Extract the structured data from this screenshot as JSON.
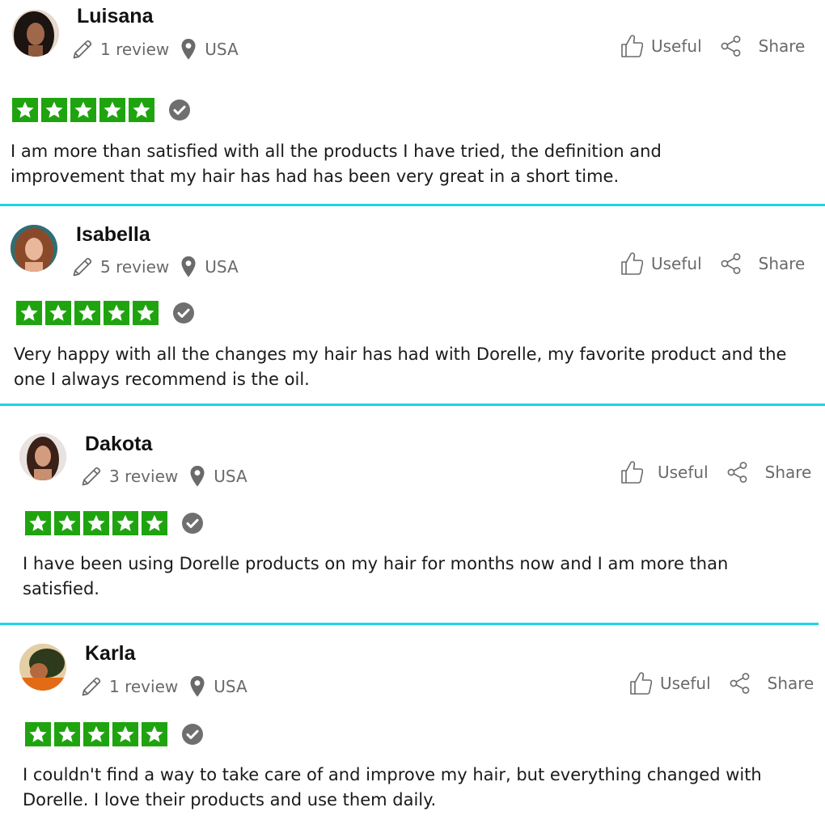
{
  "reviews": [
    {
      "name": "Luisana",
      "review_count": "1 review",
      "location": "USA",
      "useful_label": "Useful",
      "share_label": "Share",
      "rating": 5,
      "text": "I am more than satisfied with all the products I have tried, the definition and improvement that my hair has had has been very great in a short time."
    },
    {
      "name": "Isabella",
      "review_count": "5 review",
      "location": "USA",
      "useful_label": "Useful",
      "share_label": "Share",
      "rating": 5,
      "text": "Very happy with all the changes my hair has had with Dorelle, my favorite product and the one I always recommend is the oil."
    },
    {
      "name": "Dakota",
      "review_count": "3 review",
      "location": "USA",
      "useful_label": "Useful",
      "share_label": "Share",
      "rating": 5,
      "text": "I have been using Dorelle products on my hair for months now and I am more than satisfied."
    },
    {
      "name": "Karla",
      "review_count": "1 review",
      "location": "USA",
      "useful_label": "Useful",
      "share_label": "Share",
      "rating": 5,
      "text": "I couldn't find a way to take care of and improve my hair, but everything changed with Dorelle. I love their products and use them daily."
    }
  ],
  "colors": {
    "star_green": "#1fa40f",
    "divider": "#22d3e6",
    "meta_gray": "#6a6a6a",
    "verified_gray": "#6f6f6f"
  },
  "icons": {
    "review": "pencil-icon",
    "location": "map-pin-icon",
    "useful": "thumbs-up-icon",
    "share": "share-icon",
    "verified": "verified-check-icon",
    "star": "star-icon"
  }
}
